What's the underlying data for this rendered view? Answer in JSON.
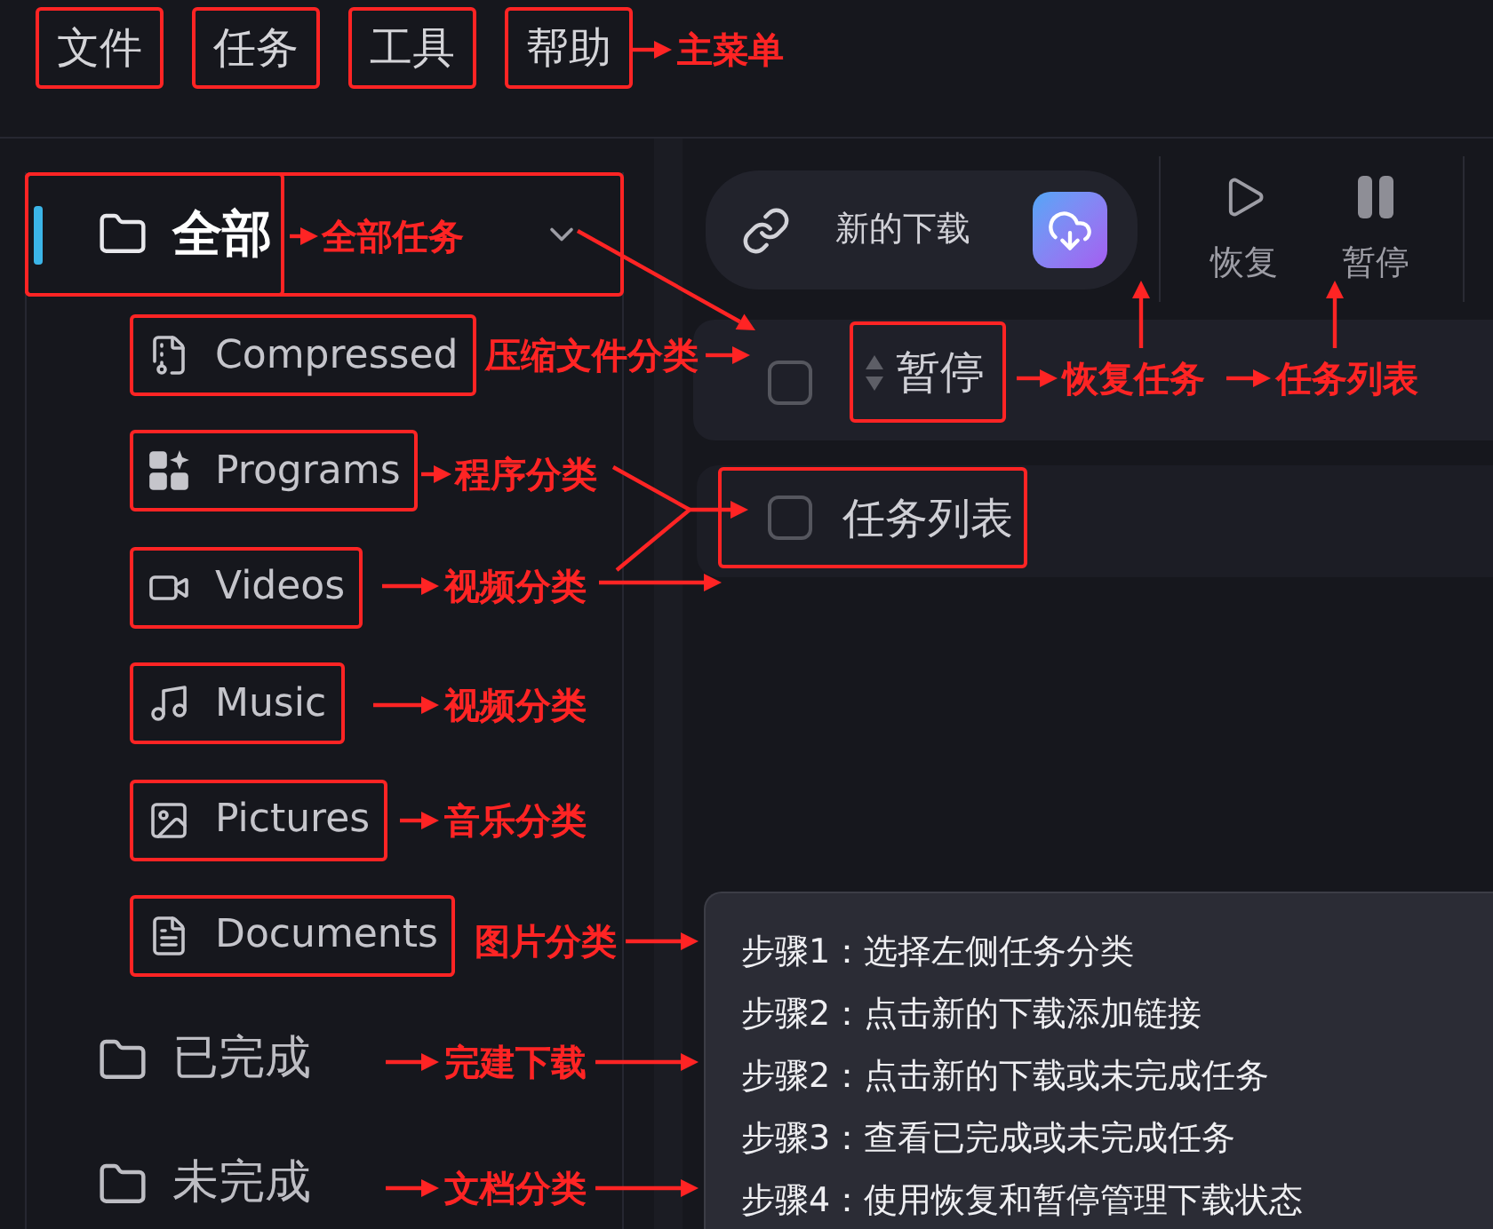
{
  "menu_bar": {
    "items": [
      {
        "label": "文件",
        "highlighted": true
      },
      {
        "label": "任务",
        "highlighted": true
      },
      {
        "label": "工具",
        "highlighted": true
      },
      {
        "label": "帮助",
        "highlighted": true
      }
    ]
  },
  "sidebar": {
    "items": [
      {
        "label": "全部",
        "selected": true,
        "highlighted": true,
        "label_highlighted": true,
        "expanded": true,
        "children": [
          {
            "label": "Compressed",
            "kind": "compressed",
            "selected": false,
            "highlighted": true
          },
          {
            "label": "Programs",
            "kind": "programs",
            "selected": false,
            "highlighted": true
          },
          {
            "label": "Videos",
            "kind": "videos",
            "selected": false,
            "highlighted": true
          },
          {
            "label": "Music",
            "kind": "music",
            "selected": false,
            "highlighted": true
          },
          {
            "label": "Pictures",
            "kind": "pictures",
            "selected": false,
            "highlighted": true
          },
          {
            "label": "Documents",
            "kind": "documents",
            "selected": false,
            "highlighted": true
          }
        ]
      },
      {
        "label": "已完成",
        "selected": false,
        "highlighted": false,
        "label_highlighted": false
      },
      {
        "label": "未完成",
        "selected": false,
        "highlighted": false,
        "label_highlighted": false
      }
    ]
  },
  "toolbar": {
    "new_download": {
      "label": "新的下载"
    },
    "buttons": [
      {
        "label": "恢复",
        "kind": "resume"
      },
      {
        "label": "暂停",
        "kind": "pause"
      }
    ]
  },
  "task_list": {
    "header": {
      "label": "暂停",
      "checked": false,
      "highlighted": true
    },
    "rows": [
      {
        "label": "任务列表",
        "checked": false,
        "highlighted": true
      }
    ]
  },
  "tooltip": {
    "lines": [
      "步骤1：选择左侧任务分类",
      "步骤2：点击新的下载添加链接",
      "步骤2：点击新的下载或未完成任务",
      "步骤3：查看已完成或未完成任务",
      "步骤4：使用恢复和暂停管理下载状态"
    ]
  },
  "annotations": [
    "主菜单",
    "全部任务",
    "压缩文件分类",
    "恢复任务",
    "任务列表",
    "程序分类",
    "视频分类",
    "视频分类",
    "音乐分类",
    "图片分类",
    "完建下载",
    "文档分类"
  ]
}
